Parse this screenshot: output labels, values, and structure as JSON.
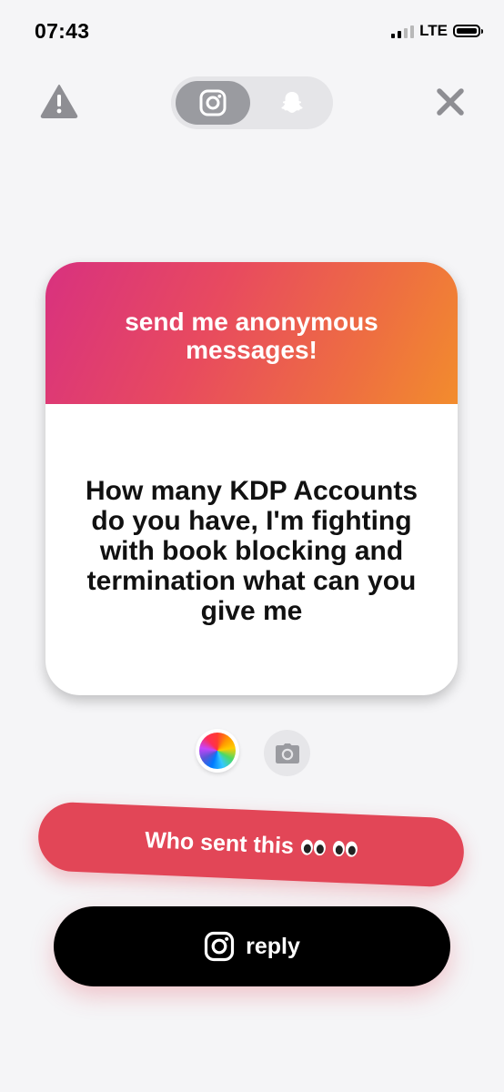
{
  "status_bar": {
    "time": "07:43",
    "network": "LTE"
  },
  "top_bar": {
    "warning_icon": "warning-triangle-icon",
    "platforms": [
      {
        "name": "Instagram",
        "icon": "instagram-icon",
        "selected": true
      },
      {
        "name": "Snapchat",
        "icon": "snapchat-ghost-icon",
        "selected": false
      }
    ],
    "close_icon": "close-x-icon"
  },
  "card": {
    "title": "send me anonymous messages!",
    "question": "How many KDP Accounts do you have, I'm fighting with book blocking and termination what can you give me",
    "gradient_colors": [
      "#d8317f",
      "#f28c2d"
    ]
  },
  "tools": {
    "color_icon": "color-wheel-icon",
    "camera_icon": "camera-icon"
  },
  "who_sent": {
    "label": "Who sent this",
    "emoji": "👀 👀",
    "color": "#e24657"
  },
  "reply": {
    "label": "reply",
    "icon": "instagram-icon",
    "color": "#000000"
  }
}
